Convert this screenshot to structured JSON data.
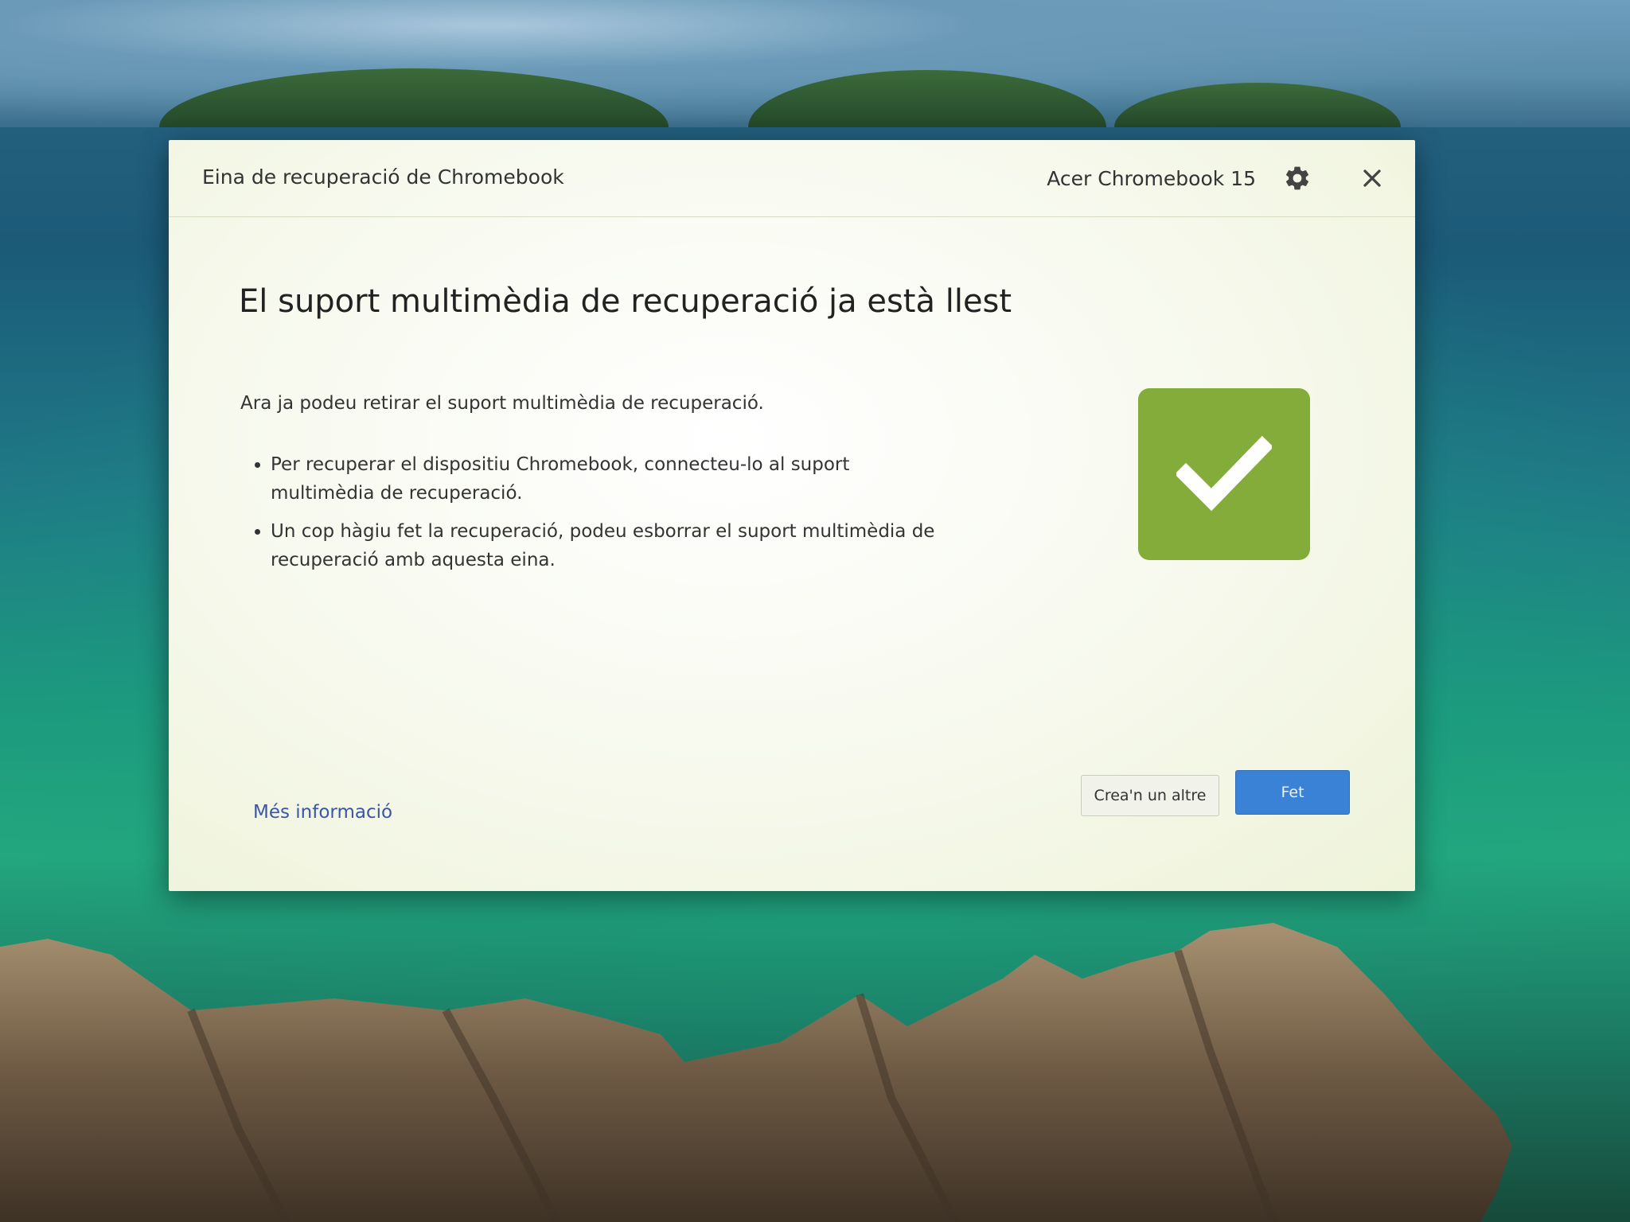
{
  "window": {
    "app_title": "Eina de recuperació de Chromebook",
    "device_name": "Acer Chromebook 15",
    "settings_icon": "gear-icon",
    "close_icon": "close-icon"
  },
  "content": {
    "heading": "El suport multimèdia de recuperació ja està llest",
    "intro": "Ara ja podeu retirar el suport multimèdia de recuperació.",
    "bullets": [
      "Per recuperar el dispositiu Chromebook, connecteu-lo al suport multimèdia de recuperació.",
      "Un cop hàgiu fet la recuperació, podeu esborrar el suport multimèdia de recuperació amb aquesta eina."
    ],
    "status_icon": "checkmark-icon"
  },
  "footer": {
    "more_info_link": "Més informació",
    "create_another_button": "Crea'n un altre",
    "done_button": "Fet"
  },
  "colors": {
    "success_green": "#84ac3a",
    "primary_blue": "#3a82d6",
    "link_blue": "#3b55a8"
  }
}
